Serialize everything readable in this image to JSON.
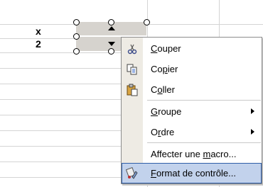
{
  "sheet": {
    "cells": [
      {
        "id": "x",
        "text": "x"
      },
      {
        "id": "two",
        "text": "2"
      }
    ]
  },
  "context_menu": {
    "items": [
      {
        "pre": "",
        "key": "C",
        "post": "ouper",
        "icon": "scissors-icon",
        "submenu": false
      },
      {
        "pre": "Co",
        "key": "p",
        "post": "ier",
        "icon": "copy-icon",
        "submenu": false
      },
      {
        "pre": "C",
        "key": "o",
        "post": "ller",
        "icon": "paste-icon",
        "submenu": false
      },
      {
        "pre": "",
        "key": "G",
        "post": "roupe",
        "icon": "",
        "submenu": true
      },
      {
        "pre": "O",
        "key": "r",
        "post": "dre",
        "icon": "",
        "submenu": true
      },
      {
        "pre": "Affecter une ",
        "key": "m",
        "post": "acro...",
        "icon": "",
        "submenu": false
      },
      {
        "pre": "",
        "key": "F",
        "post": "ormat de contrôle...",
        "icon": "format-control-icon",
        "submenu": false,
        "highlighted": true
      }
    ]
  },
  "colors": {
    "highlight": "#c2d2ec",
    "gutter": "#eeebe4",
    "control_face": "#d6d3ce"
  }
}
